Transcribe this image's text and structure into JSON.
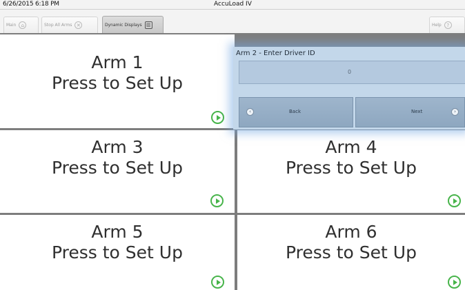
{
  "header": {
    "datetime": "6/26/2015  6:18 PM",
    "title": "AccuLoad IV",
    "buttons": {
      "main": "Main",
      "stop_all_arms": "Stop All Arms",
      "dynamic_displays": "Dynamic Displays",
      "help": "Help"
    }
  },
  "tiles": [
    {
      "arm": "Arm 1",
      "action": "Press to Set Up"
    },
    {
      "arm": "Arm 3",
      "action": "Press to Set Up"
    },
    {
      "arm": "Arm 4",
      "action": "Press to Set Up"
    },
    {
      "arm": "Arm 5",
      "action": "Press to Set Up"
    },
    {
      "arm": "Arm 6",
      "action": "Press to Set Up"
    }
  ],
  "arm2_panel": {
    "title": "Arm 2 - Enter Driver ID",
    "value": "0",
    "back_label": "Back",
    "next_label": "Next"
  },
  "icons": {
    "go": "play-circle-icon",
    "home": "home-icon",
    "stop": "stop-icon",
    "displays": "displays-icon",
    "help": "help-icon",
    "back": "back-arrow-icon",
    "next": "next-arrow-icon"
  },
  "colors": {
    "go_icon": "#47b44a",
    "panel_bg": "#c3d7ea",
    "grid_lines": "#7d7d7d"
  }
}
